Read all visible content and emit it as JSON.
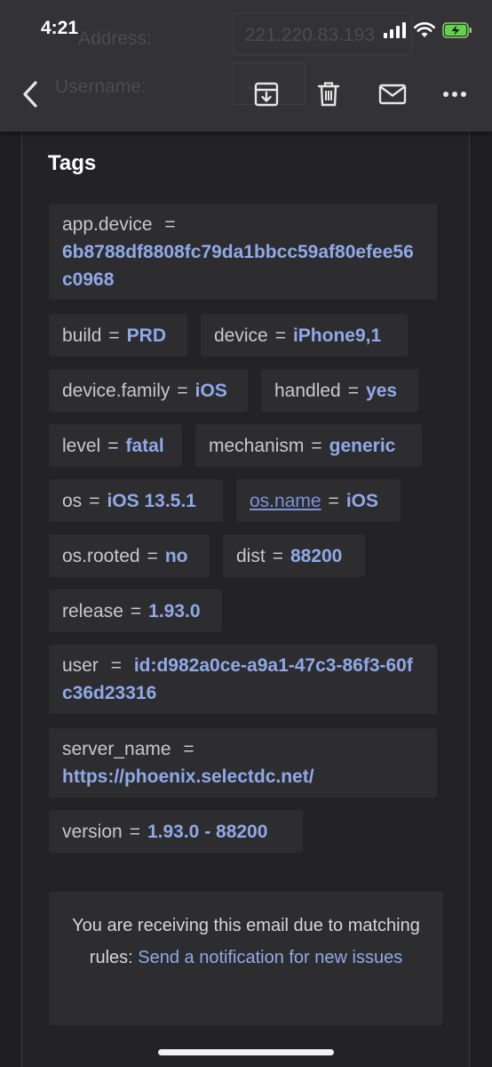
{
  "status_bar": {
    "time": "4:21"
  },
  "background_ghost": {
    "label1": "Address:",
    "value1": "221.220.83.193",
    "label2": "Username:",
    "value2": "..."
  },
  "toolbar": {
    "back": "chevron-left-icon",
    "archive": "archive-icon",
    "delete": "trash-icon",
    "mail": "mail-icon",
    "more": "more-icon"
  },
  "tags_heading": "Tags",
  "tags": [
    {
      "key": "app.device",
      "value": "6b8788df8808fc79da1bbcc59af80efee56c0968"
    },
    {
      "key": "build",
      "value": "PRD"
    },
    {
      "key": "device",
      "value": "iPhone9,1"
    },
    {
      "key": "device.family",
      "value": "iOS"
    },
    {
      "key": "handled",
      "value": "yes"
    },
    {
      "key": "level",
      "value": "fatal"
    },
    {
      "key": "mechanism",
      "value": "generic"
    },
    {
      "key": "os",
      "value": "iOS 13.5.1"
    },
    {
      "key": "os.name",
      "value": "iOS"
    },
    {
      "key": "os.rooted",
      "value": "no"
    },
    {
      "key": "dist",
      "value": "88200"
    },
    {
      "key": "release",
      "value": "1.93.0"
    },
    {
      "key": "user",
      "value": "id:d982a0ce-a9a1-47c3-86f3-60fc36d23316"
    },
    {
      "key": "server_name",
      "value": "https://phoenix.selectdc.net/"
    },
    {
      "key": "version",
      "value": "1.93.0 - 88200"
    }
  ],
  "equals": "=",
  "footer": {
    "text": "You are receiving this email due to matching rules:",
    "link": "Send a notification for new issues"
  },
  "colors": {
    "accent": "#8fa9e8",
    "background": "#1f1f21",
    "tag_bg": "#2d2d30",
    "topbar": "#333335"
  }
}
